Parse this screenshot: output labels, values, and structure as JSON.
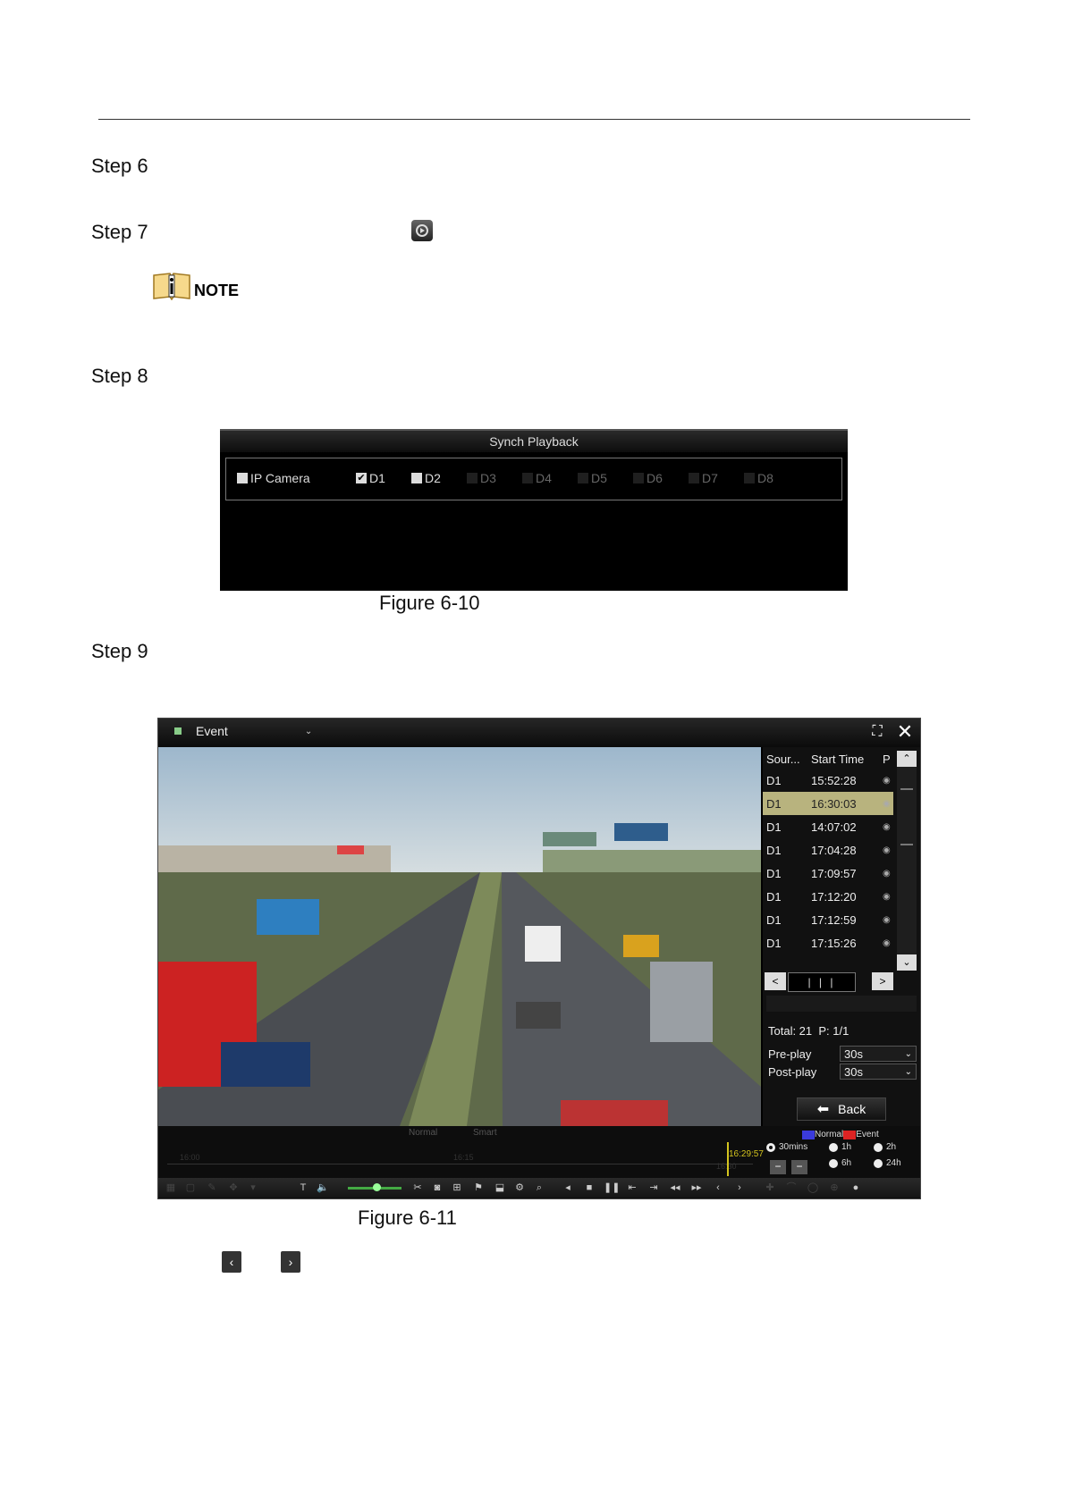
{
  "steps": [
    "Step 6",
    "Step 7",
    "Step 8",
    "Step 9"
  ],
  "note_label": "NOTE",
  "synch_playback": {
    "title": "Synch Playback",
    "group_label": "IP Camera",
    "channels": [
      {
        "label": "D1",
        "checked": true,
        "enabled": true
      },
      {
        "label": "D2",
        "checked": false,
        "enabled": true
      },
      {
        "label": "D3",
        "checked": false,
        "enabled": false
      },
      {
        "label": "D4",
        "checked": false,
        "enabled": false
      },
      {
        "label": "D5",
        "checked": false,
        "enabled": false
      },
      {
        "label": "D6",
        "checked": false,
        "enabled": false
      },
      {
        "label": "D7",
        "checked": false,
        "enabled": false
      },
      {
        "label": "D8",
        "checked": false,
        "enabled": false
      }
    ]
  },
  "figure_10_caption": "Figure 6-10",
  "playback": {
    "mode": "Event",
    "list_headers": [
      "Sour...",
      "Start Time",
      "P"
    ],
    "rows": [
      {
        "source": "D1",
        "start": "15:52:28",
        "selected": false
      },
      {
        "source": "D1",
        "start": "16:30:03",
        "selected": true
      },
      {
        "source": "D1",
        "start": "14:07:02",
        "selected": false
      },
      {
        "source": "D1",
        "start": "17:04:28",
        "selected": false
      },
      {
        "source": "D1",
        "start": "17:09:57",
        "selected": false
      },
      {
        "source": "D1",
        "start": "17:12:20",
        "selected": false
      },
      {
        "source": "D1",
        "start": "17:12:59",
        "selected": false
      },
      {
        "source": "D1",
        "start": "17:15:26",
        "selected": false
      }
    ],
    "page_indicator": "| | |",
    "total": "Total: 21",
    "page": "P: 1/1",
    "pre_play_label": "Pre-play",
    "pre_play_value": "30s",
    "post_play_label": "Post-play",
    "post_play_value": "30s",
    "back_label": "Back",
    "timeline": {
      "legend_normal": "Normal",
      "legend_smart": "Smart",
      "tick_1600": "16:00",
      "tick_1615": "16:15",
      "tick_1630": "16:30",
      "current_time": "16:29:57",
      "type_normal": "Normal",
      "type_event": "Event",
      "ranges": [
        "30mins",
        "1h",
        "2h",
        "6h",
        "24h"
      ],
      "selected_range": "30mins"
    },
    "colors": {
      "normal": "#3b3bdc",
      "event": "#dc2323",
      "selected_row": "#b8b37e"
    }
  },
  "figure_11_caption": "Figure 6-11"
}
